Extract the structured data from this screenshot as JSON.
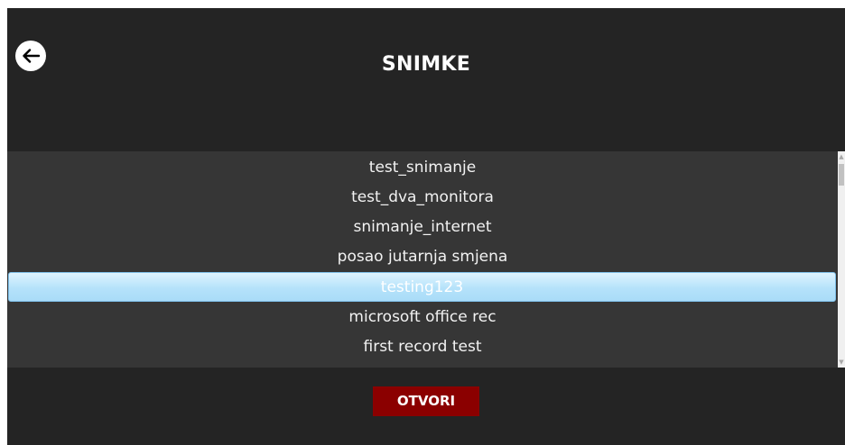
{
  "header": {
    "title": "SNIMKE",
    "back_icon": "arrow-left-icon"
  },
  "recordings": {
    "items": [
      {
        "label": "test_snimanje",
        "selected": false
      },
      {
        "label": "test_dva_monitora",
        "selected": false
      },
      {
        "label": "snimanje_internet",
        "selected": false
      },
      {
        "label": "posao jutarnja smjena",
        "selected": false
      },
      {
        "label": "testing123",
        "selected": true
      },
      {
        "label": "microsoft office rec",
        "selected": false
      },
      {
        "label": "first record test",
        "selected": false
      }
    ]
  },
  "actions": {
    "open_label": "OTVORI"
  },
  "colors": {
    "background": "#242424",
    "list_background": "#363636",
    "selection": "#b5e2fa",
    "open_button": "#8b0000"
  }
}
